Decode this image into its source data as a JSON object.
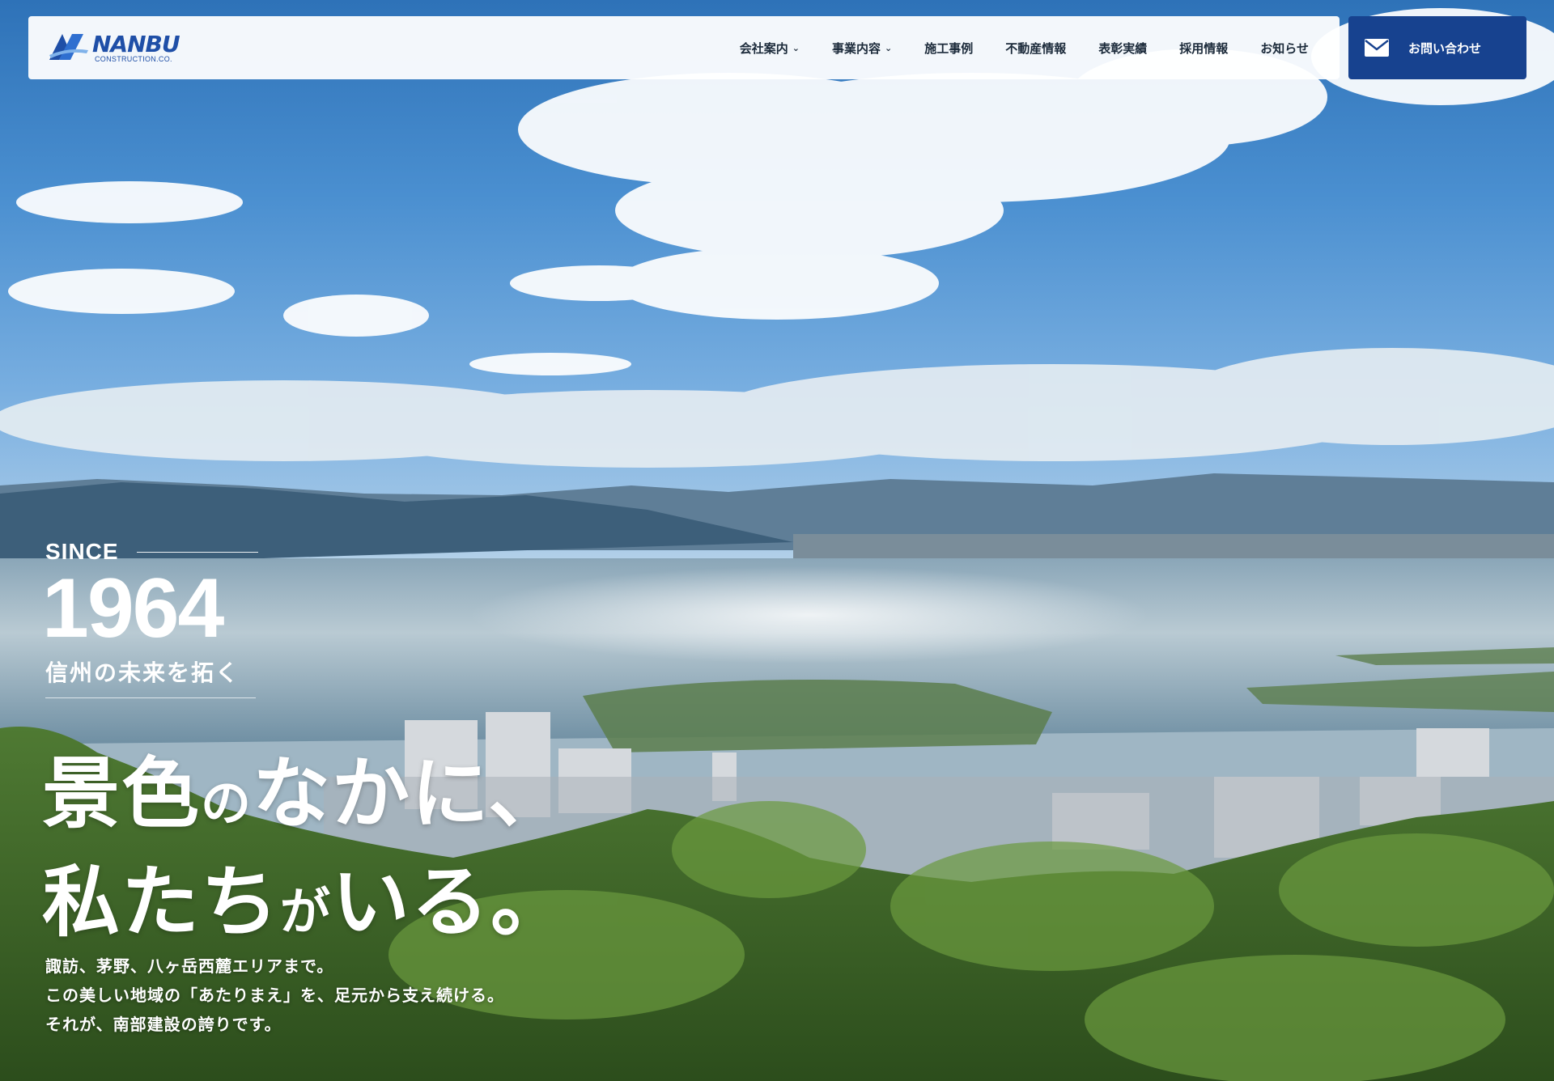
{
  "brand": {
    "name": "NANBU",
    "sub": "CONSTRUCTION.CO."
  },
  "nav": {
    "items": [
      {
        "label": "会社案内",
        "has_dropdown": true
      },
      {
        "label": "事業内容",
        "has_dropdown": true
      },
      {
        "label": "施工事例",
        "has_dropdown": false
      },
      {
        "label": "不動産情報",
        "has_dropdown": false
      },
      {
        "label": "表彰実績",
        "has_dropdown": false
      },
      {
        "label": "採用情報",
        "has_dropdown": false
      },
      {
        "label": "お知らせ",
        "has_dropdown": false
      }
    ],
    "contact": {
      "label": "お問い合わせ",
      "icon": "mail-icon"
    }
  },
  "hero": {
    "since": "SINCE",
    "year": "1964",
    "tagline": "信州の未来を拓く",
    "headline": {
      "line1_a": "景色",
      "line1_b": "の",
      "line1_c": "なかに、",
      "line2_a": "私たち",
      "line2_b": "が",
      "line2_c": "いる。"
    },
    "body": [
      "諏訪、茅野、八ヶ岳西麓エリアまで。",
      "この美しい地域の「あたりまえ」を、足元から支え続ける。",
      "それが、南部建設の誇りです。"
    ]
  },
  "colors": {
    "brand_blue": "#1f4fa7",
    "contact_bg": "#17428f",
    "text_dark": "#1b2a3a"
  }
}
